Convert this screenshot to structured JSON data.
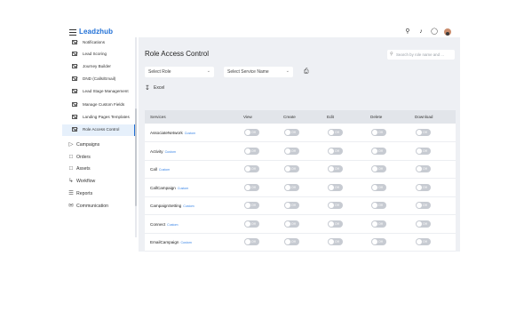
{
  "app": {
    "logo": "Leadzhub"
  },
  "topbar": {
    "icons": [
      "search-icon",
      "bell-icon",
      "globe-icon",
      "avatar"
    ]
  },
  "sidebar": {
    "sub_items": [
      {
        "label": "Notifications",
        "icon": "mail-icon"
      },
      {
        "label": "Lead Scoring",
        "icon": "mail-icon"
      },
      {
        "label": "Journey Builder",
        "icon": "mail-icon"
      },
      {
        "label": "DND (Calls/Email)",
        "icon": "mail-icon"
      },
      {
        "label": "Lead Stage Management",
        "icon": "mail-icon"
      },
      {
        "label": "Manage Custom Fields",
        "icon": "mail-icon"
      },
      {
        "label": "Landing Pages Templates",
        "icon": "mail-icon"
      },
      {
        "label": "Role Access Control",
        "icon": "mail-icon",
        "active": true
      }
    ],
    "nav_items": [
      {
        "label": "Campaigns",
        "icon": "send-icon"
      },
      {
        "label": "Orders",
        "icon": "file-icon"
      },
      {
        "label": "Assets",
        "icon": "file-icon"
      },
      {
        "label": "Workflow",
        "icon": "workflow-icon"
      },
      {
        "label": "Reports",
        "icon": "list-icon"
      },
      {
        "label": "Communication",
        "icon": "mail-icon"
      }
    ]
  },
  "main": {
    "title": "Role Access Control",
    "search_placeholder": "Search by role name and ...",
    "select_role": "Select Role",
    "select_service": "Select Service Name",
    "excel_label": "Excel",
    "columns": [
      "Services",
      "View",
      "Create",
      "Edit",
      "Delete",
      "Download"
    ],
    "toggle_label": "Off",
    "custom_tag": "Custom",
    "rows": [
      {
        "service": "AssociateNetwork",
        "tag": "Custom"
      },
      {
        "service": "Activity",
        "tag": "Custom"
      },
      {
        "service": "Call",
        "tag": "Custom"
      },
      {
        "service": "CallCampaign",
        "tag": "Custom"
      },
      {
        "service": "CampaignSetting",
        "tag": "Custom"
      },
      {
        "service": "Connect",
        "tag": "Custom"
      },
      {
        "service": "EmailCampaign",
        "tag": "Custom"
      }
    ]
  }
}
